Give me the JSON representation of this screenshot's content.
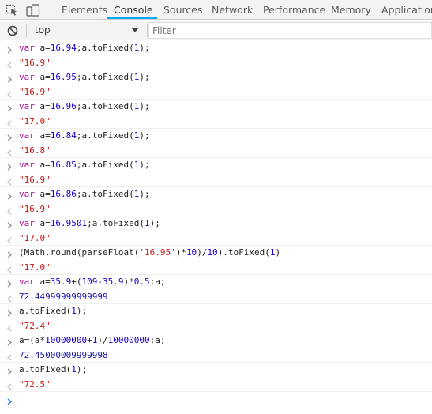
{
  "tabs": [
    {
      "label": "Elements",
      "active": false
    },
    {
      "label": "Console",
      "active": true
    },
    {
      "label": "Sources",
      "active": false
    },
    {
      "label": "Network",
      "active": false
    },
    {
      "label": "Performance",
      "active": false
    },
    {
      "label": "Memory",
      "active": false
    },
    {
      "label": "Application",
      "active": false
    }
  ],
  "toolbar": {
    "context": "top",
    "filter_placeholder": "Filter"
  },
  "colors": {
    "active_tab_underline": "#03a9f4",
    "keyword": "#aa0d91",
    "number": "#1c00cf",
    "string": "#c41a16"
  },
  "console": [
    {
      "in": "var a=16.94;a.toFixed(1);",
      "out": "\"16.9\""
    },
    {
      "in": "var a=16.95;a.toFixed(1);",
      "out": "\"16.9\""
    },
    {
      "in": "var a=16.96;a.toFixed(1);",
      "out": "\"17.0\""
    },
    {
      "in": "var a=16.84;a.toFixed(1);",
      "out": "\"16.8\""
    },
    {
      "in": "var a=16.85;a.toFixed(1);",
      "out": "\"16.9\""
    },
    {
      "in": "var a=16.86;a.toFixed(1);",
      "out": "\"16.9\""
    },
    {
      "in": "var a=16.9501;a.toFixed(1);",
      "out": "\"17.0\""
    },
    {
      "in": "(Math.round(parseFloat('16.95')*10)/10).toFixed(1)",
      "out": "\"17.0\""
    },
    {
      "in": "var a=35.9+(109-35.9)*0.5;a;",
      "out": "72.44999999999999"
    },
    {
      "in": "a.toFixed(1);",
      "out": "\"72.4\""
    },
    {
      "in": "a=(a*10000000+1)/10000000;a;",
      "out": "72.45000009999998"
    },
    {
      "in": "a.toFixed(1);",
      "out": "\"72.5\""
    }
  ]
}
